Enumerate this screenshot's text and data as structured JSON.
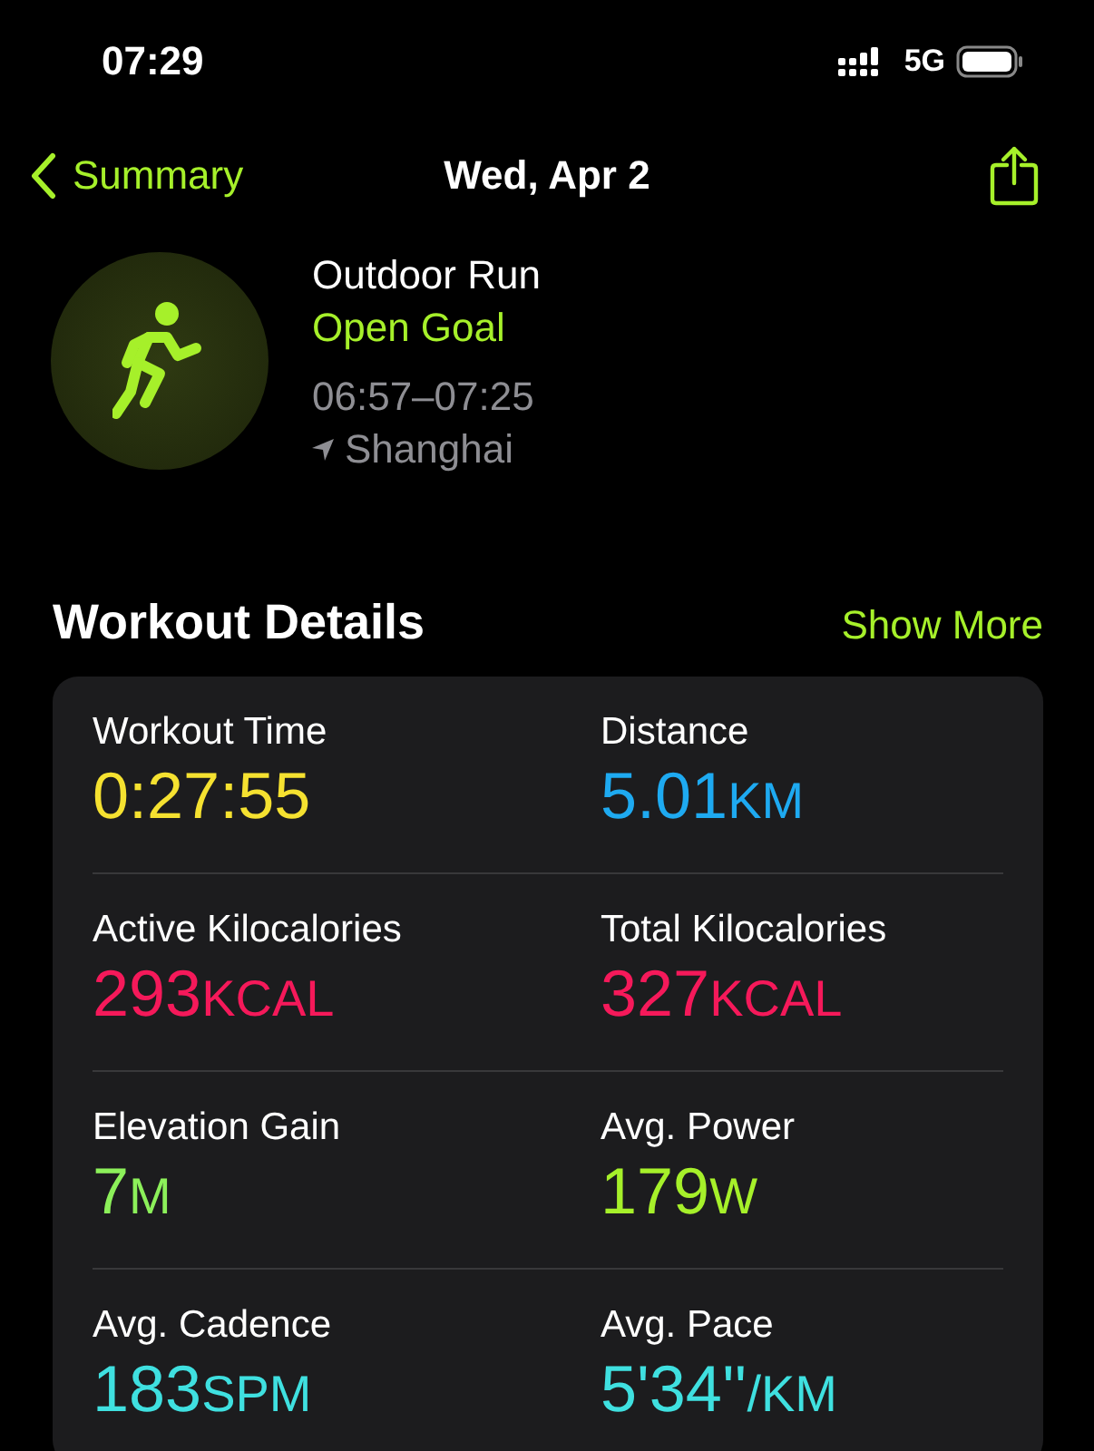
{
  "status_bar": {
    "time": "07:29",
    "network": "5G"
  },
  "nav": {
    "back_label": "Summary",
    "title": "Wed, Apr 2"
  },
  "workout": {
    "name": "Outdoor Run",
    "goal": "Open Goal",
    "time_range": "06:57–07:25",
    "location": "Shanghai"
  },
  "section": {
    "title": "Workout Details",
    "action": "Show More"
  },
  "metrics": [
    {
      "label": "Workout Time",
      "value": "0:27:55",
      "color": "#f5e130"
    },
    {
      "label": "Distance",
      "value": "5.01",
      "unit": "KM",
      "color": "#1eaaf1"
    },
    {
      "label": "Active Kilocalories",
      "value": "293",
      "unit": "KCAL",
      "color": "#f5195a"
    },
    {
      "label": "Total Kilocalories",
      "value": "327",
      "unit": "KCAL",
      "color": "#f5195a"
    },
    {
      "label": "Elevation Gain",
      "value": "7",
      "unit": "M",
      "color": "#8cf05a"
    },
    {
      "label": "Avg. Power",
      "value": "179",
      "unit": "W",
      "color": "#a6f02a"
    },
    {
      "label": "Avg. Cadence",
      "value": "183",
      "unit": "SPM",
      "color": "#3fe0e0"
    },
    {
      "label": "Avg. Pace",
      "value": "5'34''",
      "unit": "/KM",
      "color": "#3fe0e0"
    }
  ]
}
